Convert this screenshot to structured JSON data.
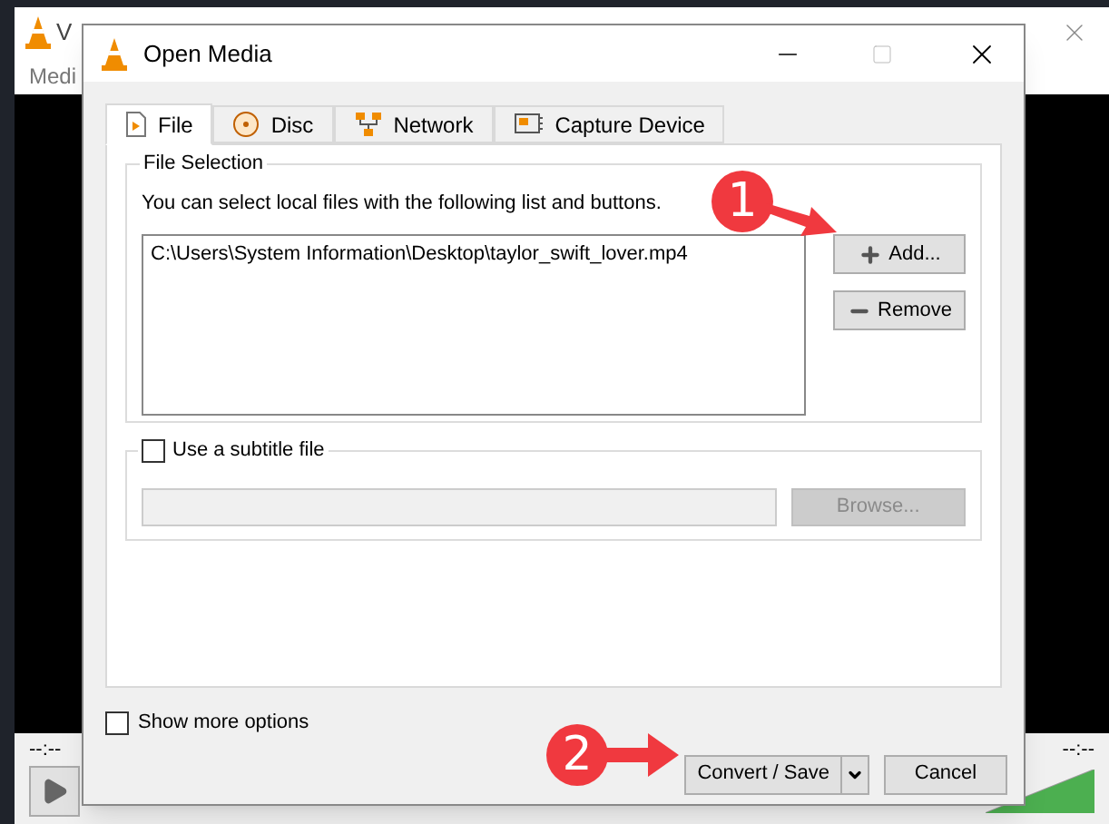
{
  "background_window": {
    "title": "V",
    "menu": [
      "Medi"
    ],
    "time_left": "--:--",
    "time_right": "--:--",
    "volume": {
      "level": 1
    }
  },
  "dialog": {
    "title": "Open Media",
    "tabs": [
      {
        "label": "File",
        "selected": true,
        "kind": "file"
      },
      {
        "label": "Disc",
        "selected": false,
        "kind": "disc"
      },
      {
        "label": "Network",
        "selected": false,
        "kind": "network"
      },
      {
        "label": "Capture Device",
        "selected": false,
        "kind": "capture"
      }
    ],
    "file_selection": {
      "label": "File Selection",
      "hint": "You can select local files with the following list and buttons.",
      "files": [
        "C:\\Users\\System Information\\Desktop\\taylor_swift_lover.mp4"
      ],
      "add_button": "Add...",
      "remove_button": "Remove"
    },
    "subtitle": {
      "label": "Use a subtitle file",
      "checked": false,
      "browse_button": {
        "label": "Browse...",
        "disabled": true
      }
    },
    "show_more_options": {
      "label": "Show more options",
      "checked": false
    },
    "buttons": {
      "convert_save": "Convert / Save",
      "cancel": "Cancel"
    }
  },
  "annotations": [
    "1",
    "2"
  ]
}
